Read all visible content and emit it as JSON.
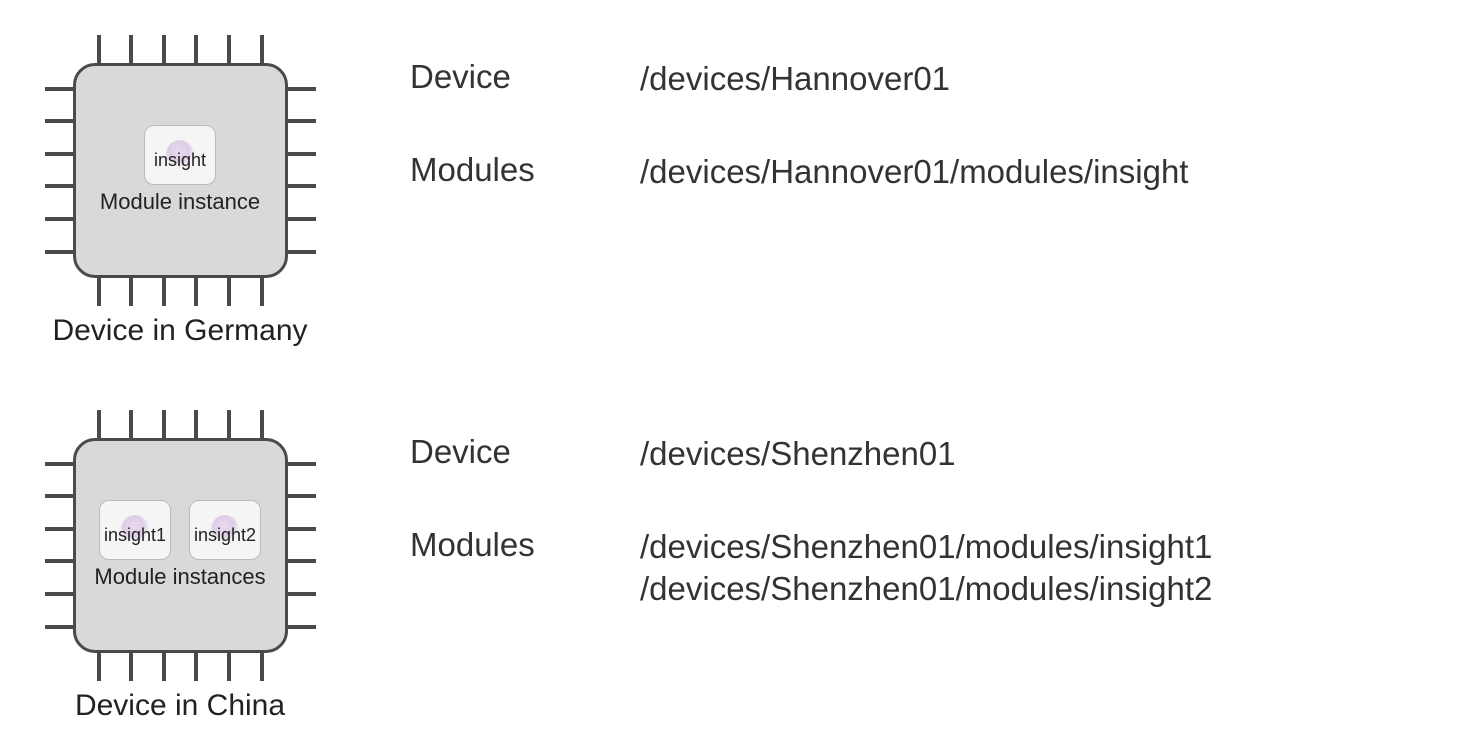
{
  "devices": [
    {
      "caption": "Device in Germany",
      "module_caption": "Module instance",
      "modules": [
        {
          "name": "insight"
        }
      ],
      "info": {
        "device_label": "Device",
        "device_path": "/devices/Hannover01",
        "modules_label": "Modules",
        "module_paths": [
          "/devices/Hannover01/modules/insight"
        ]
      }
    },
    {
      "caption": "Device in China",
      "module_caption": "Module instances",
      "modules": [
        {
          "name": "insight1"
        },
        {
          "name": "insight2"
        }
      ],
      "info": {
        "device_label": "Device",
        "device_path": "/devices/Shenzhen01",
        "modules_label": "Modules",
        "module_paths": [
          "/devices/Shenzhen01/modules/insight1",
          "/devices/Shenzhen01/modules/insight2"
        ]
      }
    }
  ]
}
